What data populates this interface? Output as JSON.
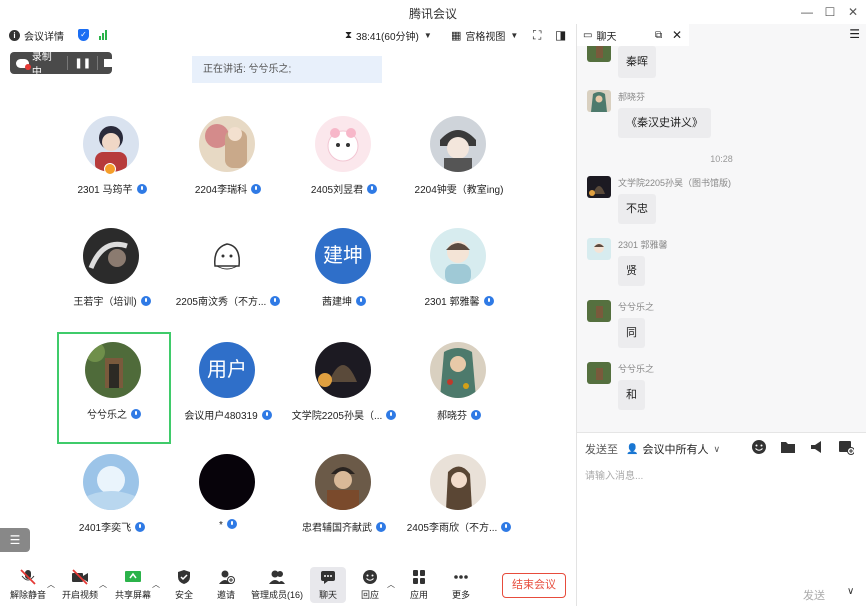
{
  "window": {
    "title": "腾讯会议"
  },
  "toolbar": {
    "meeting_details": "会议详情",
    "timer": "38:41(60分钟)",
    "view": "宫格视图"
  },
  "recording": {
    "label": "录制中"
  },
  "speaking": {
    "label": "正在讲话: 兮兮乐之;"
  },
  "participants": [
    {
      "name": "2301 马筠芊"
    },
    {
      "name": "2204李瑞科"
    },
    {
      "name": "2405刘昱君"
    },
    {
      "name": "2204钟雯（教室ing)"
    },
    {
      "name": "王若宇（培训)"
    },
    {
      "name": "2205南汶秀（不方..."
    },
    {
      "name": "茜建坤",
      "avatar_text": "建坤"
    },
    {
      "name": "2301 郭雅馨"
    },
    {
      "name": "兮兮乐之"
    },
    {
      "name": "会议用户480319",
      "avatar_text": "用户"
    },
    {
      "name": "文学院2205孙昊（..."
    },
    {
      "name": "郝晓芬"
    },
    {
      "name": "2401李奕飞"
    },
    {
      "name": "*"
    },
    {
      "name": "忠君辅国齐献武"
    },
    {
      "name": "2405李雨欣（不方..."
    }
  ],
  "bottombar": {
    "unmute": "解除静音",
    "start_video": "开启视频",
    "share_screen": "共享屏幕",
    "security": "安全",
    "invite": "邀请",
    "manage_members": "管理成员(16)",
    "chat": "聊天",
    "reactions": "回应",
    "apps": "应用",
    "more": "更多",
    "end_meeting": "结束会议"
  },
  "chat": {
    "tab": "聊天",
    "messages": [
      {
        "sender": "",
        "text": "秦晖"
      },
      {
        "sender": "郝晓芬",
        "text": "《秦汉史讲义》"
      },
      {
        "sender": "文学院2205孙昊（图书馆版)",
        "text": "不忠"
      },
      {
        "sender": "2301 郭雅馨",
        "text": "贤"
      },
      {
        "sender": "兮兮乐之",
        "text": "同"
      },
      {
        "sender": "兮兮乐之",
        "text": "和"
      }
    ],
    "timestamp": "10:28",
    "send_to_label": "发送至",
    "send_to_target": "会议中所有人",
    "input_placeholder": "请输入消息...",
    "send": "发送"
  },
  "colors": {
    "accent": "#2f6fc9",
    "active_speaker": "#3fcb6a",
    "end": "#e74c3c"
  }
}
